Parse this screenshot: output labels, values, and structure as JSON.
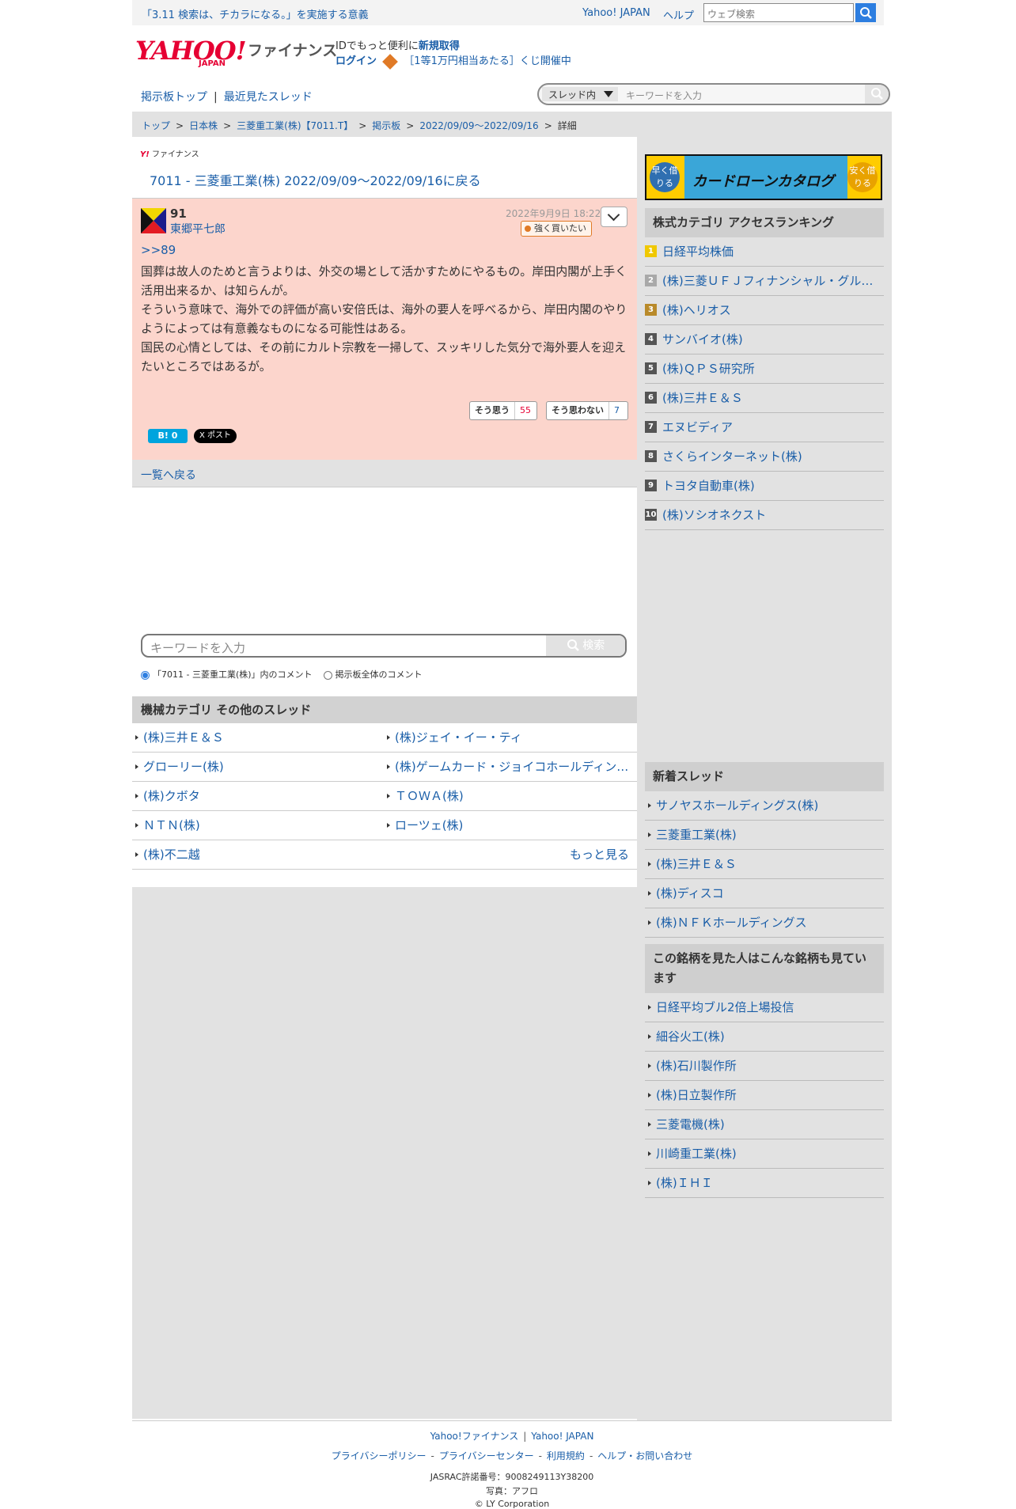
{
  "topbar": {
    "slogan": "「3.11 検索は、チカラになる。」を実施する意義",
    "yahoo_japan": "Yahoo! JAPAN",
    "help": "ヘルプ",
    "search_placeholder": "ウェブ検索"
  },
  "header": {
    "logo": "YAHOO!",
    "logo_sub": "JAPAN",
    "service": "ファイナンス",
    "id_text": "IDでもっと便利に",
    "register": "新規取得",
    "login": "ログイン",
    "promo": "［1等1万円相当あたる］くじ開催中"
  },
  "board_nav": {
    "top": "掲示板トップ",
    "recent": "最近見たスレッド",
    "scope": "スレッド内",
    "keyword_placeholder": "キーワードを入力"
  },
  "breadcrumb": [
    "トップ",
    "日本株",
    "三菱重工業(株)【7011.T】",
    "掲示板",
    "2022/09/09〜2022/09/16",
    "詳細"
  ],
  "thread": {
    "mini_logo_y": "Y!",
    "mini_logo_text": "ファイナンス",
    "back_link": "7011 - 三菱重工業(株) 2022/09/09〜2022/09/16に戻る"
  },
  "post": {
    "number": "91",
    "author": "東郷平七郎",
    "date": "2022年9月9日 18:22",
    "sentiment": "強く買いたい",
    "reply_to": ">>89",
    "lines": [
      "国葬は故人のためと言うよりは、外交の場として活かすためにやるもの。岸田内閣が上手く活用出来るか、は知らんが。",
      "そういう意味で、海外での評価が高い安倍氏は、海外の要人を呼べるから、岸田内閣のやりようによっては有意義なものになる可能性はある。",
      "国民の心情としては、その前にカルト宗教を一掃して、スッキリした気分で海外要人を迎えたいところではあるが。"
    ],
    "agree_label": "そう思う",
    "agree_count": "55",
    "disagree_label": "そう思わない",
    "disagree_count": "7",
    "hatena_label": "B! 0",
    "tweet_label": "X ポスト"
  },
  "list_back": "一覧へ戻る",
  "comment_search": {
    "placeholder": "キーワードを入力",
    "button": "検索",
    "option_this": "「7011 - 三菱重工業(株)」内のコメント",
    "option_all": "掲示板全体のコメント"
  },
  "other_threads": {
    "title": "機械カテゴリ その他のスレッド",
    "items": [
      "(株)三井Ｅ＆Ｓ",
      "(株)ジェイ・イー・ティ",
      "グローリー(株)",
      "(株)ゲームカード・ジョイコホールディングス",
      "(株)クボタ",
      "ＴＯＷＡ(株)",
      "ＮＴＮ(株)",
      "ローツェ(株)",
      "(株)不二越"
    ],
    "more": "もっと見る"
  },
  "ad": {
    "left": "早く借りる",
    "title": "カードローンカタログ",
    "right": "安く借りる"
  },
  "ranking": {
    "title": "株式カテゴリ アクセスランキング",
    "items": [
      "日経平均株価",
      "(株)三菱ＵＦＪフィナンシャル・グループ",
      "(株)ヘリオス",
      "サンバイオ(株)",
      "(株)ＱＰＳ研究所",
      "(株)三井Ｅ＆Ｓ",
      "エヌビディア",
      "さくらインターネット(株)",
      "トヨタ自動車(株)",
      "(株)ソシオネクスト"
    ]
  },
  "new_threads": {
    "title": "新着スレッド",
    "items": [
      "サノヤスホールディングス(株)",
      "三菱重工業(株)",
      "(株)三井Ｅ＆Ｓ",
      "(株)ディスコ",
      "(株)ＮＦＫホールディングス"
    ]
  },
  "also_viewed": {
    "title": "この銘柄を見た人はこんな銘柄も見ています",
    "items": [
      "日経平均ブル2倍上場投信",
      "細谷火工(株)",
      "(株)石川製作所",
      "(株)日立製作所",
      "三菱電機(株)",
      "川崎重工業(株)",
      "(株)ＩＨＩ"
    ]
  },
  "footer": {
    "fin": "Yahoo!ファイナンス",
    "yj": "Yahoo! JAPAN",
    "privacy": "プライバシーポリシー",
    "privacy_center": "プライバシーセンター",
    "terms": "利用規約",
    "help": "ヘルプ・お問い合わせ",
    "jasrac": "JASRAC許諾番号：9008249113Y38200",
    "photo": "写真：アフロ",
    "copyright": "© LY Corporation"
  },
  "colors": {
    "brand_red": "#e60033",
    "link_blue": "#1a5ea8",
    "post_bg": "#fcd5cc",
    "sentiment_orange": "#e07a26"
  }
}
